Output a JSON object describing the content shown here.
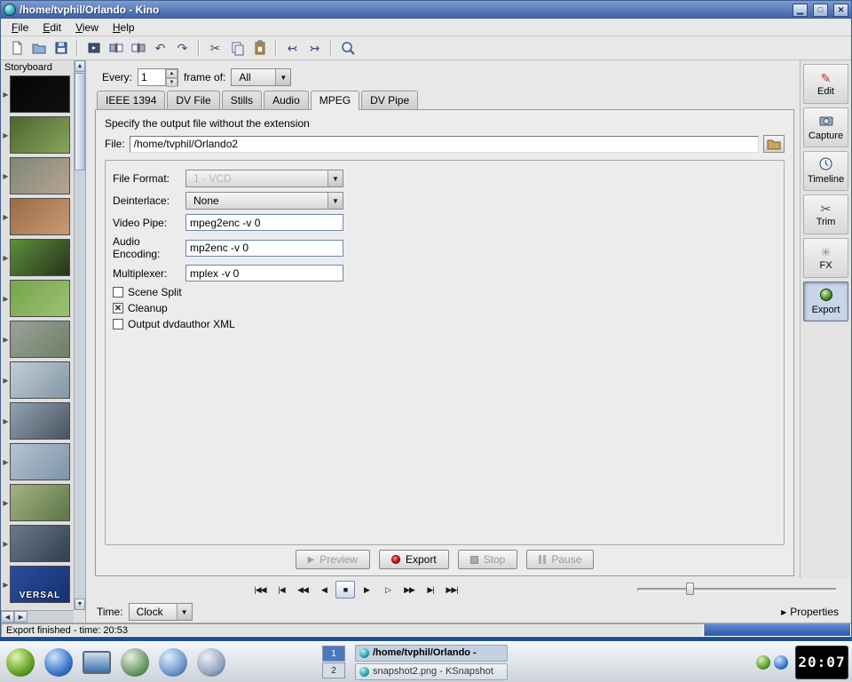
{
  "window": {
    "title": "/home/tvphil/Orlando - Kino"
  },
  "menubar": {
    "items": [
      "File",
      "Edit",
      "View",
      "Help"
    ]
  },
  "toolbar": {
    "icons": [
      "new-file",
      "open-file",
      "save-file",
      "capture-frame",
      "split-before",
      "split-after",
      "undo",
      "redo",
      "cut",
      "copy",
      "paste",
      "seek-backward",
      "seek-forward",
      "zoom"
    ]
  },
  "storyboard": {
    "title": "Storyboard",
    "thumbnails": [
      {
        "c1": "#050505",
        "c2": "#101010"
      },
      {
        "c1": "#49662e",
        "c2": "#8aa45e"
      },
      {
        "c1": "#7d8777",
        "c2": "#b9a390"
      },
      {
        "c1": "#9c6b46",
        "c2": "#c89a74"
      },
      {
        "c1": "#5d8f3c",
        "c2": "#26331b"
      },
      {
        "c1": "#76a44c",
        "c2": "#9cc272"
      },
      {
        "c1": "#9aa29a",
        "c2": "#6f7f63"
      },
      {
        "c1": "#c2cdd4",
        "c2": "#8296a6"
      },
      {
        "c1": "#93a3b3",
        "c2": "#47535f"
      },
      {
        "c1": "#b4c4d2",
        "c2": "#7e94a8"
      },
      {
        "c1": "#a4b486",
        "c2": "#5c7446"
      },
      {
        "c1": "#6a7a88",
        "c2": "#303f4e"
      },
      {
        "c1": "#2b4ea0",
        "c2": "#16306e",
        "text": "VERSAL"
      }
    ]
  },
  "frame_row": {
    "every_label": "Every:",
    "every_value": "1",
    "frame_label": "frame of:",
    "frame_value": "All"
  },
  "tabs": {
    "items": [
      {
        "label": "IEEE 1394"
      },
      {
        "label": "DV File"
      },
      {
        "label": "Stills"
      },
      {
        "label": "Audio"
      },
      {
        "label": "MPEG",
        "active": true
      },
      {
        "label": "DV Pipe"
      }
    ]
  },
  "export_panel": {
    "instruction": "Specify the output file without the extension",
    "file_label": "File:",
    "file_value": "/home/tvphil/Orlando2",
    "file_format_label": "File Format:",
    "file_format_value": "1 - VCD",
    "deinterlace_label": "Deinterlace:",
    "deinterlace_value": "None",
    "video_pipe_label": "Video Pipe:",
    "video_pipe_value": "mpeg2enc -v 0",
    "audio_encoding_label": "Audio Encoding:",
    "audio_encoding_value": "mp2enc -v 0",
    "multiplexer_label": "Multiplexer:",
    "multiplexer_value": "mplex -v 0",
    "checkboxes": [
      {
        "label": "Scene Split",
        "checked": false
      },
      {
        "label": "Cleanup",
        "checked": true
      },
      {
        "label": "Output dvdauthor XML",
        "checked": false
      }
    ],
    "buttons": [
      {
        "label": "Preview",
        "enabled": false
      },
      {
        "label": "Export",
        "enabled": true
      },
      {
        "label": "Stop",
        "enabled": false
      },
      {
        "label": "Pause",
        "enabled": false
      }
    ]
  },
  "sidebar": {
    "items": [
      {
        "label": "Edit"
      },
      {
        "label": "Capture"
      },
      {
        "label": "Timeline"
      },
      {
        "label": "Trim"
      },
      {
        "label": "FX"
      },
      {
        "label": "Export",
        "active": true
      }
    ]
  },
  "transport": {
    "buttons": [
      {
        "glyph": "|◀◀"
      },
      {
        "glyph": "|◀"
      },
      {
        "glyph": "◀◀"
      },
      {
        "glyph": "◀"
      },
      {
        "glyph": "■",
        "active": true
      },
      {
        "glyph": "▶"
      },
      {
        "glyph": "▷"
      },
      {
        "glyph": "▶▶"
      },
      {
        "glyph": "▶|"
      },
      {
        "glyph": "▶▶|"
      }
    ]
  },
  "time_row": {
    "label": "Time:",
    "value": "Clock",
    "properties_label": "Properties"
  },
  "statusbar": {
    "text": "Export finished - time: 20:53"
  },
  "taskbar": {
    "pager": [
      {
        "label": "1",
        "active": true
      },
      {
        "label": "2"
      }
    ],
    "tasks": [
      {
        "label": "/home/tvphil/Orlando - ",
        "active": true
      },
      {
        "label": "snapshot2.png - KSnapshot"
      }
    ],
    "clock": "20:07"
  }
}
